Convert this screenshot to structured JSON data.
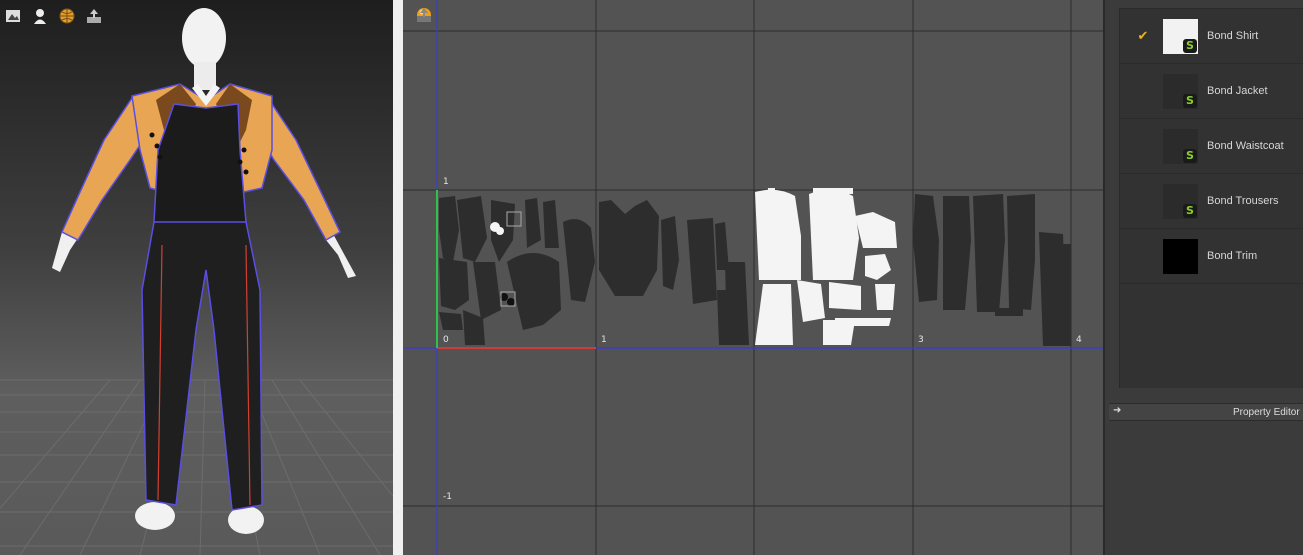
{
  "viewport3d": {
    "toolbar": [
      {
        "icon": "image-icon"
      },
      {
        "icon": "avatar-icon"
      },
      {
        "icon": "globe-icon"
      },
      {
        "icon": "export-icon"
      }
    ],
    "colors": {
      "jacket": "#e8a553",
      "waistcoat": "#1b1b1b",
      "trousers": "#1f1f1f",
      "seam": "#5a4fe0",
      "piping": "#d24030",
      "avatar": "#f2f2f2"
    }
  },
  "uv_editor": {
    "toolbar": [
      {
        "icon": "orange-ball-icon"
      },
      {
        "icon": "export-icon"
      }
    ],
    "axis_labels": {
      "y_top": "1",
      "y_bottom": "-1",
      "x0": "0",
      "x1": "1",
      "x3": "3",
      "x4": "4"
    },
    "colors": {
      "background": "#535353",
      "grid": "#2c2c2c",
      "axis": "#3a3ad8",
      "u_axis": "#d03a3a",
      "v_axis": "#2ec24a",
      "piece_dark": "#2d2d2d",
      "piece_light": "#f4f4f4"
    }
  },
  "materials": {
    "items": [
      {
        "name": "Bond Shirt",
        "checked": true,
        "check_mark": "✔",
        "badge": "S",
        "thumb": "#f2f2f2"
      },
      {
        "name": "Bond Jacket",
        "checked": false,
        "check_mark": "",
        "badge": "S",
        "thumb": "#2b2b2b"
      },
      {
        "name": "Bond Waistcoat",
        "checked": false,
        "check_mark": "",
        "badge": "S",
        "thumb": "#2b2b2b"
      },
      {
        "name": "Bond Trousers",
        "checked": false,
        "check_mark": "",
        "badge": "S",
        "thumb": "#2b2b2b"
      },
      {
        "name": "Bond Trim",
        "checked": false,
        "check_mark": "",
        "badge": "",
        "thumb": "#000000"
      }
    ]
  },
  "property_editor": {
    "title": "Property Editor",
    "toggle_icon": "arrow-right-icon"
  }
}
